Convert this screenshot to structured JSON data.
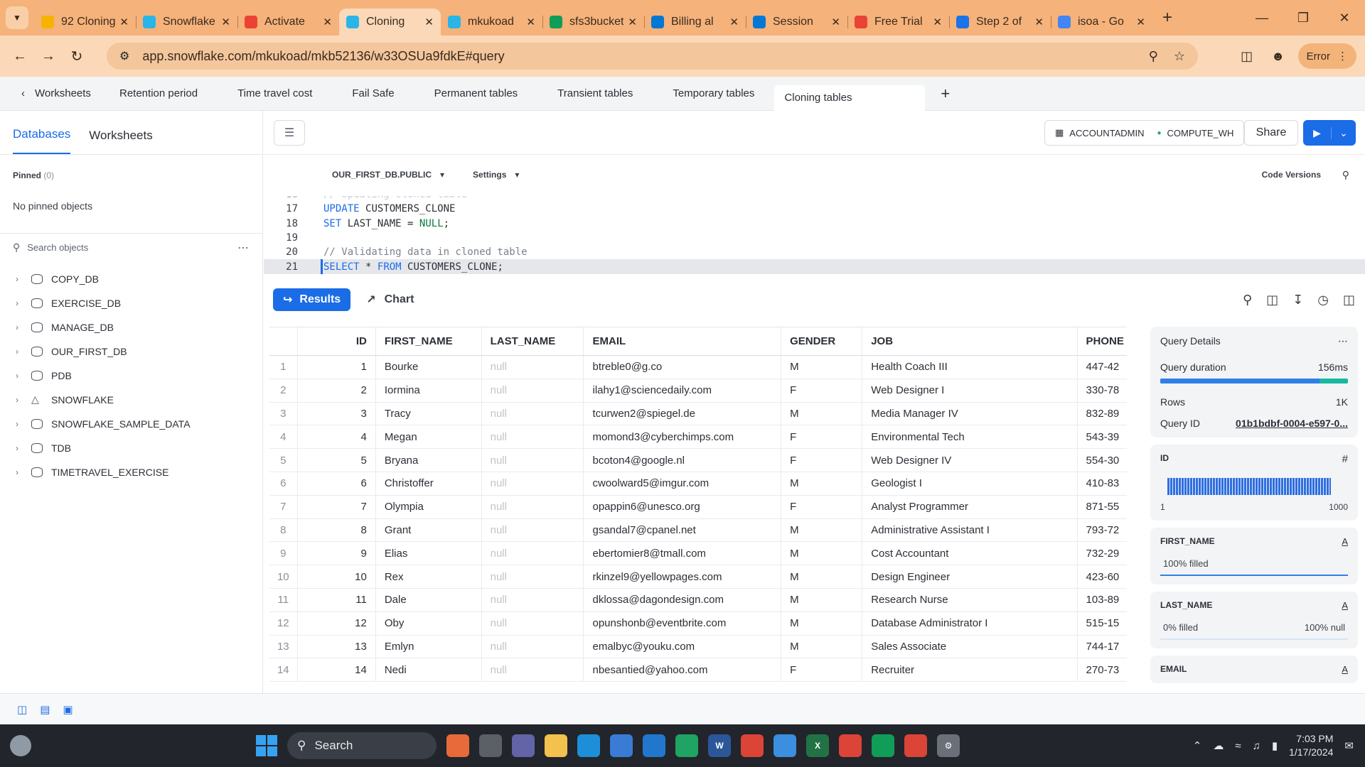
{
  "browser": {
    "tabs": [
      {
        "label": "92 Cloning",
        "icon": "google-drive-icon",
        "color": "#f4b400",
        "active": false
      },
      {
        "label": "Snowflake",
        "icon": "snowflake-icon",
        "color": "#29b5e8",
        "active": false
      },
      {
        "label": "Activate",
        "icon": "gmail-icon",
        "color": "#ea4335",
        "active": false
      },
      {
        "label": "Cloning",
        "icon": "snowflake-icon",
        "color": "#29b5e8",
        "active": true
      },
      {
        "label": "mkukoad",
        "icon": "snowflake-icon",
        "color": "#29b5e8",
        "active": false
      },
      {
        "label": "sfs3bucket",
        "icon": "sheets-icon",
        "color": "#0f9d58",
        "active": false
      },
      {
        "label": "Billing al",
        "icon": "azure-icon",
        "color": "#0078d4",
        "active": false
      },
      {
        "label": "Session",
        "icon": "azure-icon",
        "color": "#0078d4",
        "active": false
      },
      {
        "label": "Free Trial",
        "icon": "google-cloud-icon",
        "color": "#ea4335",
        "active": false
      },
      {
        "label": "Step 2 of",
        "icon": "app-icon",
        "color": "#1a73e8",
        "active": false
      },
      {
        "label": "isoa - Go",
        "icon": "google-icon",
        "color": "#4285f4",
        "active": false
      }
    ],
    "url": "app.snowflake.com/mkukoad/mkb52136/w33OSUa9fdkE#query",
    "error_label": "Error"
  },
  "worksheet_tabs": {
    "back_label": "Worksheets",
    "tabs": [
      "Retention period",
      "Time travel cost",
      "Fail Safe",
      "Permanent tables",
      "Transient tables",
      "Temporary tables",
      "Cloning tables"
    ],
    "active_index": 6
  },
  "sidebar": {
    "tabs": [
      "Databases",
      "Worksheets"
    ],
    "pinned_label": "Pinned",
    "pinned_count": "(0)",
    "no_pinned": "No pinned objects",
    "search_placeholder": "Search objects",
    "databases": [
      {
        "name": "COPY_DB",
        "icon": "database"
      },
      {
        "name": "EXERCISE_DB",
        "icon": "database"
      },
      {
        "name": "MANAGE_DB",
        "icon": "database"
      },
      {
        "name": "OUR_FIRST_DB",
        "icon": "database"
      },
      {
        "name": "PDB",
        "icon": "database"
      },
      {
        "name": "SNOWFLAKE",
        "icon": "shared"
      },
      {
        "name": "SNOWFLAKE_SAMPLE_DATA",
        "icon": "database"
      },
      {
        "name": "TDB",
        "icon": "database"
      },
      {
        "name": "TIMETRAVEL_EXERCISE",
        "icon": "database"
      }
    ]
  },
  "editor": {
    "role": "ACCOUNTADMIN",
    "warehouse": "COMPUTE_WH",
    "share_label": "Share",
    "context": "OUR_FIRST_DB.PUBLIC",
    "settings_label": "Settings",
    "code_versions_label": "Code Versions",
    "lines": [
      {
        "n": "16",
        "text": "// Updating cloned table",
        "kind": "comment",
        "highlight": false
      },
      {
        "n": "17",
        "text": "UPDATE CUSTOMERS_CLONE",
        "kind": "update",
        "highlight": false
      },
      {
        "n": "18",
        "text": "SET LAST_NAME = NULL;",
        "kind": "set",
        "highlight": false
      },
      {
        "n": "19",
        "text": "",
        "kind": "plain",
        "highlight": false
      },
      {
        "n": "20",
        "text": "// Validating data in cloned table",
        "kind": "comment",
        "highlight": false
      },
      {
        "n": "21",
        "text": "SELECT * FROM CUSTOMERS_CLONE;",
        "kind": "select",
        "highlight": true
      }
    ]
  },
  "results": {
    "results_label": "Results",
    "chart_label": "Chart",
    "columns": [
      "",
      "ID",
      "FIRST_NAME",
      "LAST_NAME",
      "EMAIL",
      "GENDER",
      "JOB",
      "PHONE"
    ],
    "rows": [
      [
        "1",
        "1",
        "Bourke",
        "null",
        "btreble0@g.co",
        "M",
        "Health Coach III",
        "447-42"
      ],
      [
        "2",
        "2",
        "Iormina",
        "null",
        "ilahy1@sciencedaily.com",
        "F",
        "Web Designer I",
        "330-78"
      ],
      [
        "3",
        "3",
        "Tracy",
        "null",
        "tcurwen2@spiegel.de",
        "M",
        "Media Manager IV",
        "832-89"
      ],
      [
        "4",
        "4",
        "Megan",
        "null",
        "momond3@cyberchimps.com",
        "F",
        "Environmental Tech",
        "543-39"
      ],
      [
        "5",
        "5",
        "Bryana",
        "null",
        "bcoton4@google.nl",
        "F",
        "Web Designer IV",
        "554-30"
      ],
      [
        "6",
        "6",
        "Christoffer",
        "null",
        "cwoolward5@imgur.com",
        "M",
        "Geologist I",
        "410-83"
      ],
      [
        "7",
        "7",
        "Olympia",
        "null",
        "opappin6@unesco.org",
        "F",
        "Analyst Programmer",
        "871-55"
      ],
      [
        "8",
        "8",
        "Grant",
        "null",
        "gsandal7@cpanel.net",
        "M",
        "Administrative Assistant I",
        "793-72"
      ],
      [
        "9",
        "9",
        "Elias",
        "null",
        "ebertomier8@tmall.com",
        "M",
        "Cost Accountant",
        "732-29"
      ],
      [
        "10",
        "10",
        "Rex",
        "null",
        "rkinzel9@yellowpages.com",
        "M",
        "Design Engineer",
        "423-60"
      ],
      [
        "11",
        "11",
        "Dale",
        "null",
        "dklossa@dagondesign.com",
        "M",
        "Research Nurse",
        "103-89"
      ],
      [
        "12",
        "12",
        "Oby",
        "null",
        "opunshonb@eventbrite.com",
        "M",
        "Database Administrator I",
        "515-15"
      ],
      [
        "13",
        "13",
        "Emlyn",
        "null",
        "emalbyc@youku.com",
        "M",
        "Sales Associate",
        "744-17"
      ],
      [
        "14",
        "14",
        "Nedi",
        "null",
        "nbesantied@yahoo.com",
        "F",
        "Recruiter",
        "270-73"
      ]
    ]
  },
  "query_details": {
    "title": "Query Details",
    "duration_label": "Query duration",
    "duration_value": "156ms",
    "duration_fraction": 0.85,
    "rows_label": "Rows",
    "rows_value": "1K",
    "query_id_label": "Query ID",
    "query_id_value": "01b1bdbf-0004-e597-0...",
    "id_column": {
      "label": "ID",
      "min": "1",
      "max": "1000"
    },
    "first_name": {
      "label": "FIRST_NAME",
      "filled": "100% filled"
    },
    "last_name": {
      "label": "LAST_NAME",
      "filled": "0% filled",
      "null": "100% null"
    },
    "email": {
      "label": "EMAIL"
    }
  },
  "taskbar": {
    "search_label": "Search",
    "time": "7:03 PM",
    "date": "1/17/2024"
  }
}
